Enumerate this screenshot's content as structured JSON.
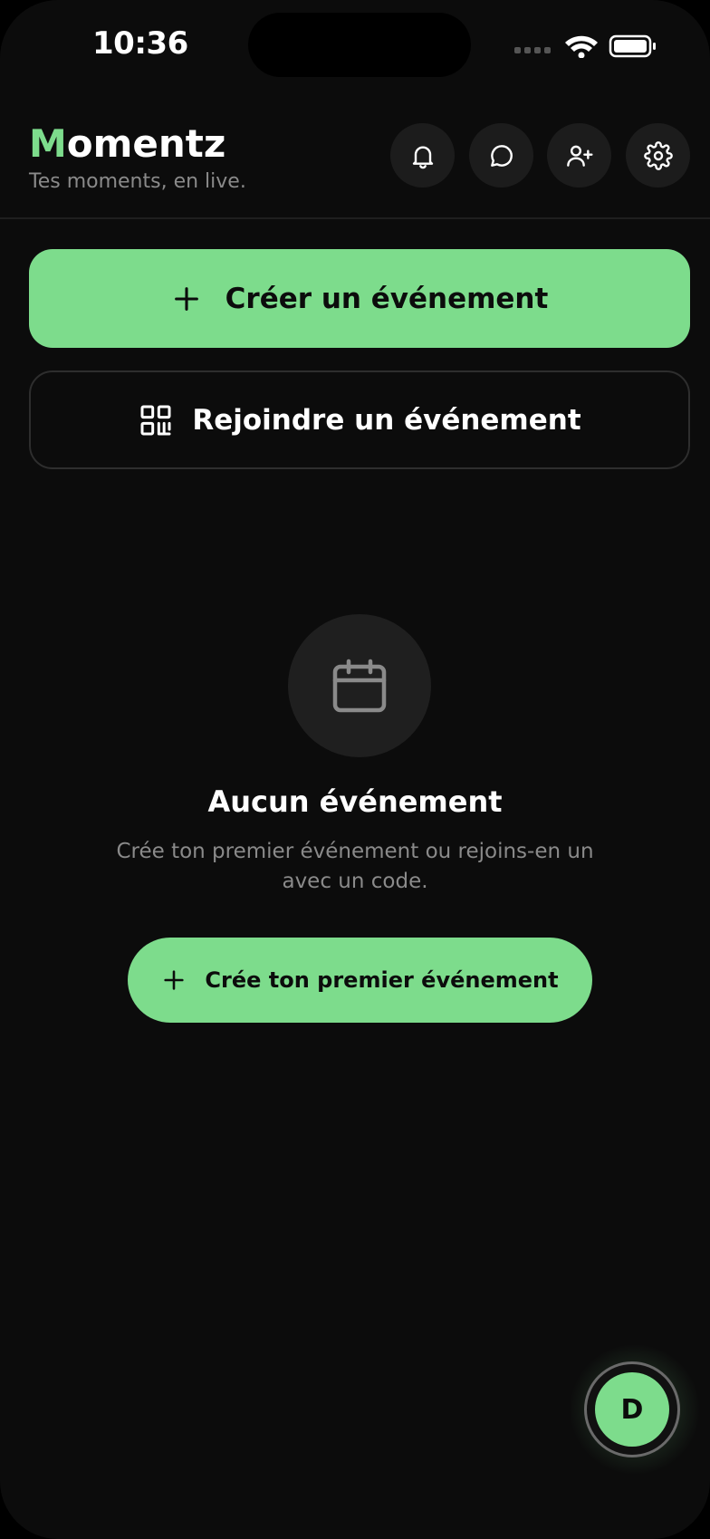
{
  "status_bar": {
    "time": "10:36"
  },
  "header": {
    "brand_first_letter": "M",
    "brand_rest": "omentz",
    "tagline": "Tes moments, en live.",
    "actions": [
      {
        "icon": "bell-icon"
      },
      {
        "icon": "chat-bubble-icon"
      },
      {
        "icon": "user-plus-icon"
      },
      {
        "icon": "gear-icon"
      }
    ]
  },
  "actions": {
    "create_label": "Créer un événement",
    "create_icon": "plus-icon",
    "join_label": "Rejoindre un événement",
    "join_icon": "qr-code-icon"
  },
  "empty_state": {
    "icon": "calendar-icon",
    "title": "Aucun événement",
    "description": "Crée ton premier événement ou rejoins-en un avec un code.",
    "cta_label": "Crée ton premier événement"
  },
  "profile": {
    "avatar_initial": "D"
  },
  "colors": {
    "background": "#0c0c0c",
    "accent": "#7ddc8c",
    "muted_text": "#8a8a8a",
    "surface": "#1c1c1c"
  }
}
